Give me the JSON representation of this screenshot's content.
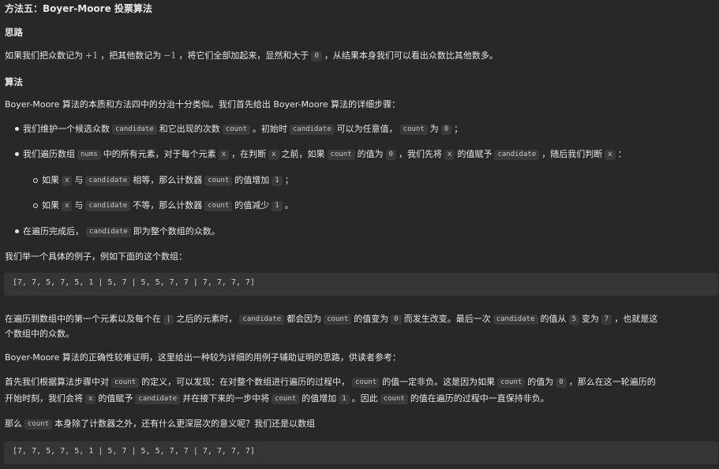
{
  "title": "方法五：Boyer-Moore 投票算法",
  "h_idea": "思路",
  "p_idea": {
    "t1": "如果我们把众数记为",
    "plus1": "+1",
    "t2": "，把其他数记为",
    "minus1": "−1",
    "t3": "，将它们全部加起来，显然和大于",
    "zero": "0",
    "t4": "，从结果本身我们可以看出众数比其他数多。"
  },
  "h_algo": "算法",
  "p_algo": "Boyer-Moore 算法的本质和方法四中的分治十分类似。我们首先给出 Boyer-Moore 算法的详细步骤：",
  "b1": {
    "t1": "我们维护一个候选众数",
    "c1": "candidate",
    "t2": "和它出现的次数",
    "c2": "count",
    "t3": "。初始时",
    "c3": "candidate",
    "t4": "可以为任意值，",
    "c4": "count",
    "t5": "为",
    "c5": "0",
    "t6": "；"
  },
  "b2": {
    "t1": "我们遍历数组",
    "c1": "nums",
    "t2": "中的所有元素，对于每个元素",
    "c2": "x",
    "t3": "，在判断",
    "c3": "x",
    "t4": "之前，如果",
    "c4": "count",
    "t5": "的值为",
    "c5": "0",
    "t6": "，我们先将",
    "c6": "x",
    "t7": "的值赋予",
    "c7": "candidate",
    "t8": "，随后我们判断",
    "c8": "x",
    "t9": "："
  },
  "s1": {
    "t1": "如果",
    "c1": "x",
    "t2": "与",
    "c2": "candidate",
    "t3": "相等，那么计数器",
    "c3": "count",
    "t4": "的值增加",
    "c4": "1",
    "t5": "；"
  },
  "s2": {
    "t1": "如果",
    "c1": "x",
    "t2": "与",
    "c2": "candidate",
    "t3": "不等，那么计数器",
    "c3": "count",
    "t4": "的值减少",
    "c4": "1",
    "t5": "。"
  },
  "b3": {
    "t1": "在遍历完成后，",
    "c1": "candidate",
    "t2": "即为整个数组的众数。"
  },
  "p_example": "我们举一个具体的例子，例如下面的这个数组：",
  "code1": "[7, 7, 5, 7, 5, 1 | 5, 7 | 5, 5, 7, 7 | 7, 7, 7, 7]",
  "p_trav1": {
    "t1": "在遍历到数组中的第一个元素以及每个在",
    "c1": "|",
    "t2": "之后的元素时，",
    "c2": "candidate",
    "t3": "都会因为",
    "c3": "count",
    "t4": "的值变为",
    "c4": "0",
    "t5": "而发生改变。最后一次",
    "c5": "candidate",
    "t6": "的值从",
    "c6": "5",
    "t7": "变为",
    "c7": "7",
    "t8": "，也就是这"
  },
  "p_trav2": "个数组中的众数。",
  "p_proof": "Boyer-Moore 算法的正确性较难证明，这里给出一种较为详细的用例子辅助证明的思路，供读者参考：",
  "p_first1": {
    "t1": "首先我们根据算法步骤中对",
    "c1": "count",
    "t2": "的定义，可以发现：在对整个数组进行遍历的过程中，",
    "c2": "count",
    "t3": "的值一定非负。这是因为如果",
    "c3": "count",
    "t4": "的值为",
    "c4": "0",
    "t5": "，那么在这一轮遍历的"
  },
  "p_first2": {
    "t1": "开始时刻，我们会将",
    "c1": "x",
    "t2": "的值赋予",
    "c2": "candidate",
    "t3": "并在接下来的一步中将",
    "c3": "count",
    "t4": "的值增加",
    "c4": "1",
    "t5": "。因此",
    "c5": "count",
    "t6": "的值在遍历的过程中一直保持非负。"
  },
  "p_count": {
    "t1": "那么",
    "c1": "count",
    "t2": "本身除了计数器之外，还有什么更深层次的意义呢？我们还是以数组"
  },
  "code2": "[7, 7, 5, 7, 5, 1 | 5, 7 | 5, 5, 7, 7 | 7, 7, 7, 7]"
}
